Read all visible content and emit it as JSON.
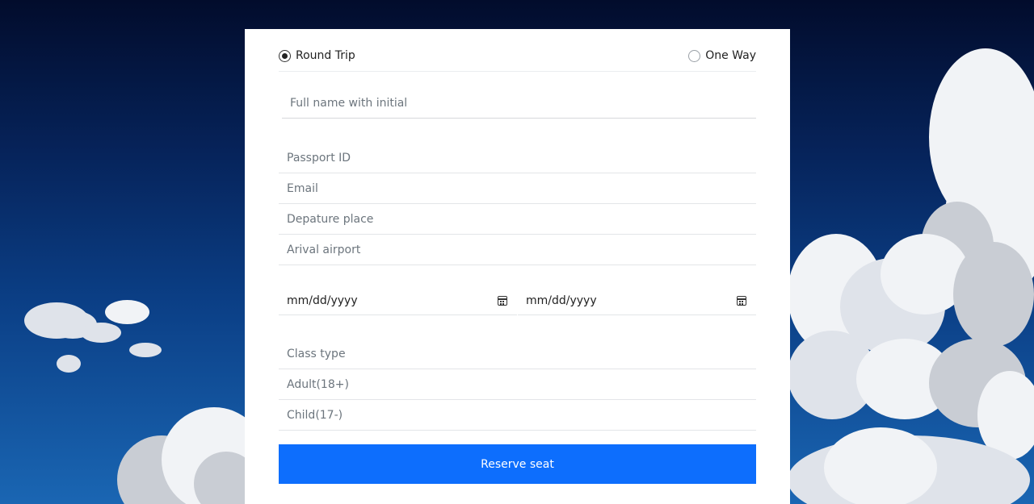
{
  "trip": {
    "round_trip_label": "Round Trip",
    "one_way_label": "One Way",
    "selected": "Round Trip"
  },
  "fields": {
    "full_name_placeholder": "Full name with initial",
    "passport_placeholder": "Passport ID",
    "email_placeholder": "Email",
    "departure_placeholder": "Depature place",
    "arrival_placeholder": "Arival airport",
    "date1_value": "mm/dd/yyyy",
    "date2_value": "mm/dd/yyyy",
    "class_placeholder": "Class type",
    "adult_placeholder": "Adult(18+)",
    "child_placeholder": "Child(17-)"
  },
  "actions": {
    "reserve_label": "Reserve seat"
  },
  "colors": {
    "primary": "#0d6efd",
    "sky_top": "#020c2c",
    "sky_bottom": "#1a66b3"
  }
}
